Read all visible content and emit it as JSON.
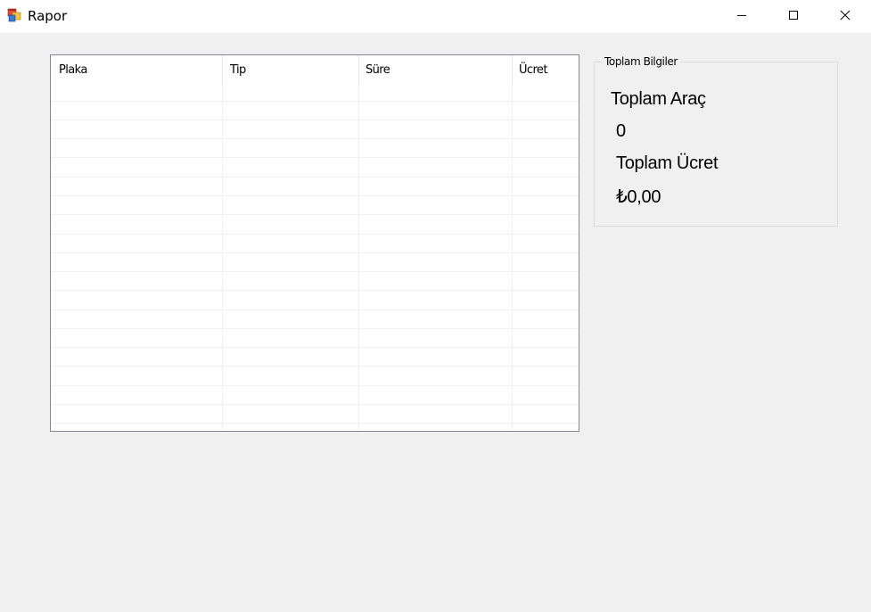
{
  "window": {
    "title": "Rapor",
    "icon": "app-window-icon",
    "controls": [
      "minimize-icon",
      "maximize-icon",
      "close-icon"
    ]
  },
  "listview": {
    "columns": [
      {
        "label": "Plaka"
      },
      {
        "label": "Tip"
      },
      {
        "label": "Süre"
      },
      {
        "label": "Ücret"
      }
    ],
    "rows": []
  },
  "summary": {
    "group_title": "Toplam Bilgiler",
    "total_vehicles_label": "Toplam Araç",
    "total_vehicles_value": "0",
    "total_fee_label": "Toplam Ücret",
    "total_fee_value": "₺0,00"
  }
}
